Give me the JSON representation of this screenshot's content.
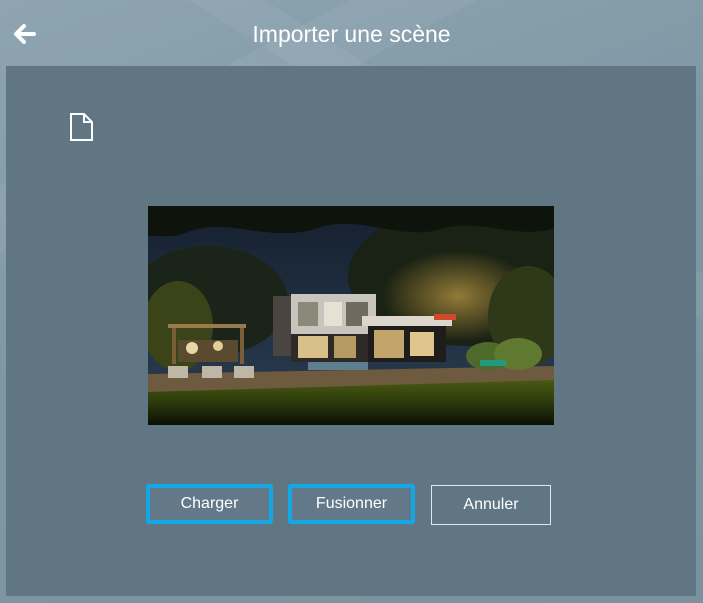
{
  "dialog": {
    "title": "Importer une scène"
  },
  "header": {
    "back_icon": "arrow-left-icon"
  },
  "panel": {
    "file_icon": "document-icon",
    "preview_alt": "Aperçu de la scène"
  },
  "buttons": {
    "load_label": "Charger",
    "merge_label": "Fusionner",
    "cancel_label": "Annuler"
  },
  "colors": {
    "accent": "#13a7e6",
    "panel": "#607683",
    "header": "#8ea5b1"
  }
}
